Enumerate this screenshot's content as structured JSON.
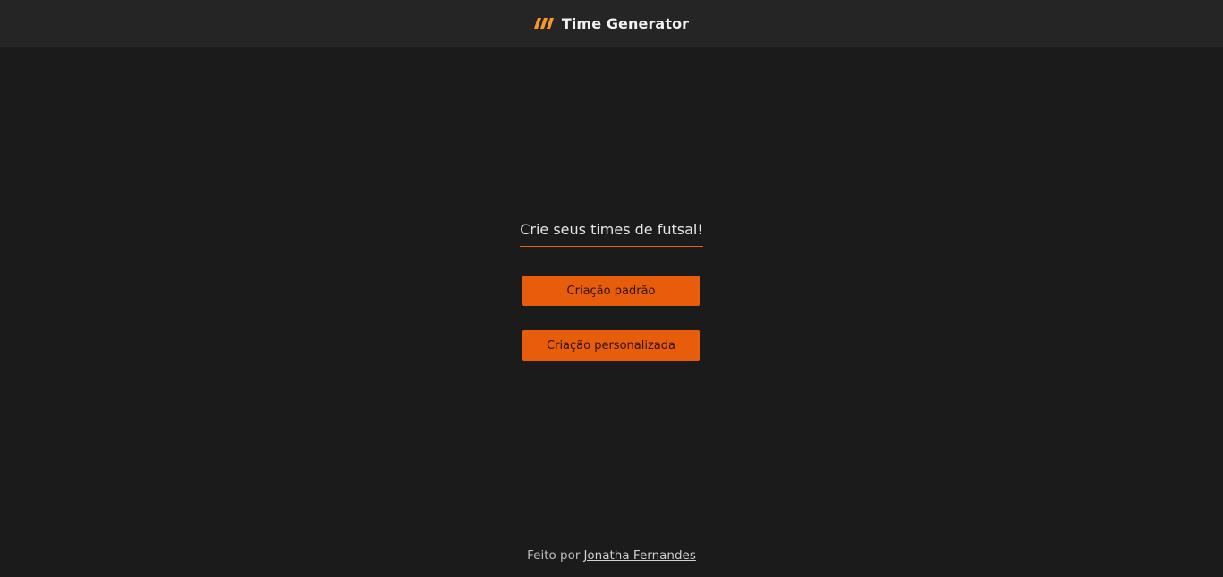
{
  "header": {
    "logo_icon": "slashes-logo-icon",
    "title": "Time Generator"
  },
  "main": {
    "headline": "Crie seus times de futsal!",
    "buttons": {
      "standard_label": "Criação padrão",
      "custom_label": "Criação personalizada"
    }
  },
  "footer": {
    "prefix": "Feito por",
    "author_link": "Jonatha Fernandes"
  },
  "colors": {
    "background": "#1b1b1b",
    "header_background": "#252525",
    "accent": "#e85d0c",
    "logo_accent": "#f59a2a"
  }
}
